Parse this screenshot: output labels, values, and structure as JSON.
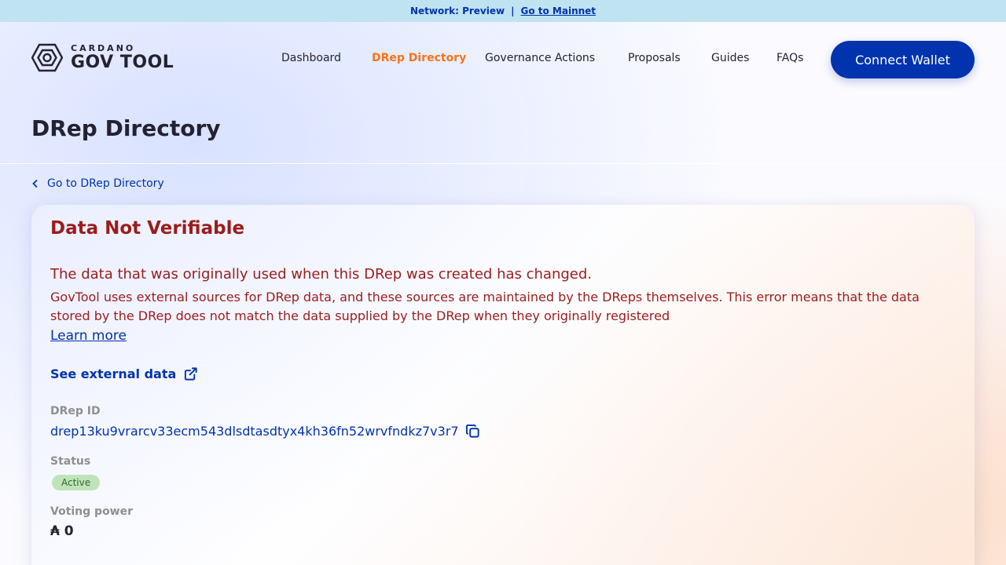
{
  "topbar": {
    "network": "Network: Preview",
    "separator": "|",
    "mainnet_link": "Go to Mainnet"
  },
  "logo": {
    "small": "CARDANO",
    "big": "GOV TOOL"
  },
  "nav": {
    "items": [
      "Dashboard",
      "DRep Directory",
      "Governance Actions",
      "Proposals",
      "Guides",
      "FAQs"
    ],
    "active": "DRep Directory",
    "connect_label": "Connect Wallet"
  },
  "page": {
    "title": "DRep Directory",
    "back_label": "Go to DRep Directory"
  },
  "card": {
    "error_title": "Data Not Verifiable",
    "error_subtitle": "The data that was originally used when this DRep was created has changed.",
    "error_body": "GovTool uses external sources for DRep data, and these sources are maintained by the DReps themselves. This error means that the data stored by the DRep does not match the data supplied by the DRep when they originally registered",
    "learn_more": "Learn more",
    "external_link": "See external data",
    "drep_id_label": "DRep ID",
    "drep_id": "drep13ku9vrarcv33ecm543dlsdtasdtyx4kh36fn52wrvfndkz7v3r7",
    "status_label": "Status",
    "status": "Active",
    "voting_power_label": "Voting power",
    "voting_power": "₳ 0"
  },
  "colors": {
    "primary": "#0033ad",
    "active_nav": "#f97316",
    "error": "#9b1c1c",
    "status_badge": "#c0e4ba",
    "topbar": "#bfe3f1"
  },
  "icons": [
    "gov-tool-logo-icon",
    "chevron-left-icon",
    "external-link-icon",
    "copy-icon"
  ]
}
